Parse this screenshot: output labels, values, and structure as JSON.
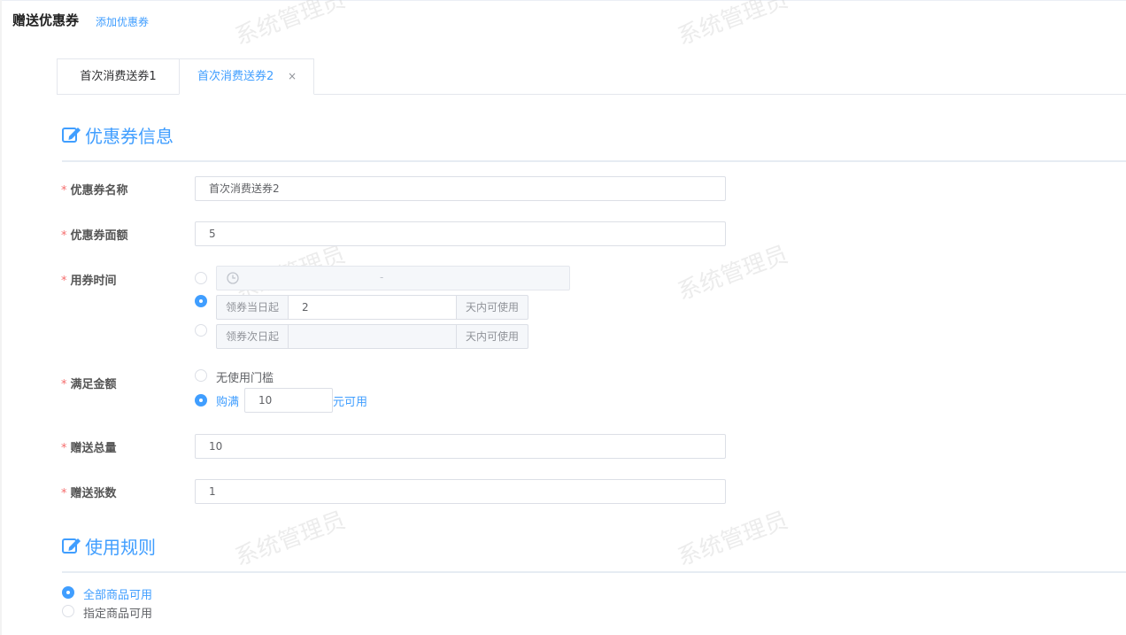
{
  "header": {
    "title": "赠送优惠券",
    "add_link": "添加优惠券"
  },
  "tabs": [
    {
      "label": "首次消费送券1",
      "active": false
    },
    {
      "label": "首次消费送券2",
      "active": true,
      "close": "×"
    }
  ],
  "sections": {
    "info": {
      "title": "优惠券信息"
    },
    "rules": {
      "title": "使用规则"
    }
  },
  "form": {
    "required_mark": "*",
    "name": {
      "label": "优惠券名称",
      "value": "首次消费送券2"
    },
    "amount": {
      "label": "优惠券面额",
      "value": "5"
    },
    "time": {
      "label": "用券时间",
      "range_separator": "-",
      "selected_option": 2,
      "option2": {
        "prefix": "领券当日起",
        "value": "2",
        "suffix": "天内可使用"
      },
      "option3": {
        "prefix": "领券次日起",
        "value": "",
        "suffix": "天内可使用"
      }
    },
    "threshold": {
      "label": "满足金额",
      "option_none": "无使用门槛",
      "option_buy_prefix": "购满",
      "option_buy_value": "10",
      "option_buy_suffix": "元可用",
      "selected": "buy"
    },
    "total": {
      "label": "赠送总量",
      "value": "10"
    },
    "count": {
      "label": "赠送张数",
      "value": "1"
    }
  },
  "rules": {
    "options": [
      "全部商品可用",
      "指定商品可用"
    ],
    "selected": 0
  },
  "watermark": "系统管理员",
  "colors": {
    "accent": "#409eff",
    "required": "#f56c6c",
    "border": "#dcdfe6"
  }
}
